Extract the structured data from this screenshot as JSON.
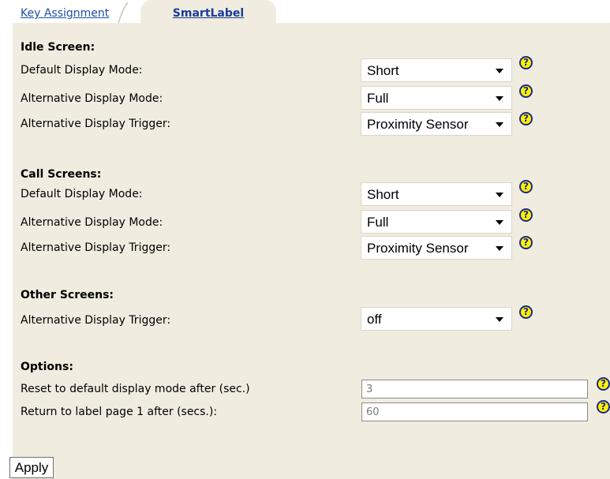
{
  "tabs": [
    {
      "label": "Key Assignment"
    },
    {
      "label": "SmartLabel"
    }
  ],
  "idle": {
    "title": "Idle Screen:",
    "default_mode_label": "Default Display Mode:",
    "default_mode_value": "Short",
    "alt_mode_label": "Alternative Display Mode:",
    "alt_mode_value": "Full",
    "alt_trigger_label": "Alternative Display Trigger:",
    "alt_trigger_value": "Proximity Sensor"
  },
  "call": {
    "title": "Call Screens:",
    "default_mode_label": "Default Display Mode:",
    "default_mode_value": "Short",
    "alt_mode_label": "Alternative Display Mode:",
    "alt_mode_value": "Full",
    "alt_trigger_label": "Alternative Display Trigger:",
    "alt_trigger_value": "Proximity Sensor"
  },
  "other": {
    "title": "Other Screens:",
    "alt_trigger_label": "Alternative Display Trigger:",
    "alt_trigger_value": "off"
  },
  "options": {
    "title": "Options:",
    "reset_label": "Reset to default display mode after (sec.)",
    "reset_value": "3",
    "return_label": "Return to label page 1 after (secs.):",
    "return_value": "60"
  },
  "help_glyph": "?",
  "apply_label": "Apply",
  "colors": {
    "panel": "#f0ede0",
    "tab_link": "#1d4fa4",
    "help_fill": "#fff200",
    "help_border": "#1c2a88"
  }
}
